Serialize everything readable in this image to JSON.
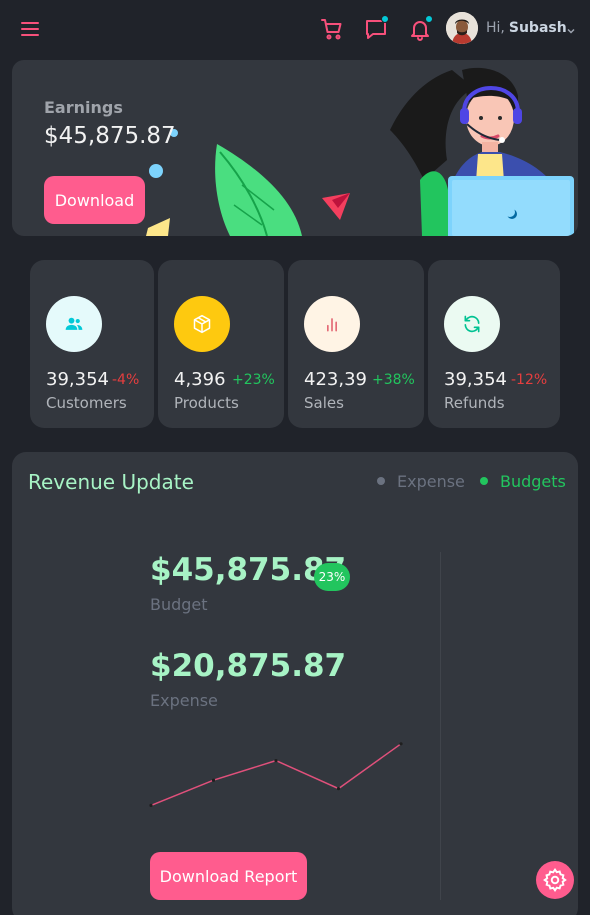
{
  "header": {
    "greeting": "Hi,",
    "user_name": "Subash",
    "icons": [
      "menu-icon",
      "cart-icon",
      "chat-icon",
      "bell-icon",
      "chevron-down-icon"
    ],
    "accent_color": "#f7507b",
    "notification_dot_color": "#03c9d7"
  },
  "earnings": {
    "label": "Earnings",
    "value": "$45,875.87",
    "button_label": "Download"
  },
  "stats": [
    {
      "value": "39,354",
      "change": "-4%",
      "label": "Customers",
      "icon": "users-icon",
      "icon_bg": "#e5fafb",
      "icon_color": "#03c9d7"
    },
    {
      "value": "4,396",
      "change": "+23%",
      "label": "Products",
      "icon": "box-icon",
      "icon_bg": "#fec90f",
      "icon_color": "#ffffff"
    },
    {
      "value": "423,39",
      "change": "+38%",
      "label": "Sales",
      "icon": "bar-chart-icon",
      "icon_bg": "#fff4e5",
      "icon_color": "#e46a76"
    },
    {
      "value": "39,354",
      "change": "-12%",
      "label": "Refunds",
      "icon": "refresh-icon",
      "icon_bg": "#ebfaf2",
      "icon_color": "#00c292"
    }
  ],
  "revenue": {
    "title": "Revenue Update",
    "legend_expense": "Expense",
    "legend_budgets": "Budgets",
    "budget_value": "$45,875.87",
    "budget_badge": "23%",
    "budget_label": "Budget",
    "expense_value": "$20,875.87",
    "expense_label": "Expense",
    "button_label": "Download Report"
  },
  "chart_data": {
    "type": "line",
    "x": [
      1,
      2,
      3,
      4,
      5
    ],
    "series": [
      {
        "values": [
          2,
          11,
          18,
          8,
          24
        ]
      }
    ],
    "color": "#e0507b",
    "ylim": [
      0,
      30
    ]
  },
  "settings": {
    "icon": "gear-icon"
  }
}
